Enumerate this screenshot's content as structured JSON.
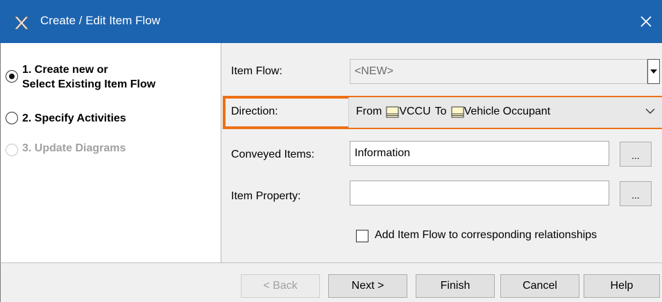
{
  "window": {
    "title": "Create / Edit Item Flow",
    "app_icon": "magicdraw-x-icon",
    "close_icon": "close-icon"
  },
  "steps": [
    {
      "line1": "1. Create new or",
      "line2": "Select Existing Item Flow",
      "selected": true,
      "enabled": true
    },
    {
      "line1": "2. Specify Activities",
      "selected": false,
      "enabled": true
    },
    {
      "line1": "3. Update Diagrams",
      "selected": false,
      "enabled": false
    }
  ],
  "form": {
    "item_flow": {
      "label": "Item Flow:",
      "value": "<NEW>"
    },
    "direction": {
      "label": "Direction:",
      "from": "From",
      "source": "VCCU",
      "to": "To",
      "target": "Vehicle Occupant",
      "highlight_color": "#ed7014"
    },
    "conveyed_items": {
      "label": "Conveyed Items:",
      "value": "Information",
      "browse": "..."
    },
    "item_property": {
      "label": "Item Property:",
      "value": "",
      "browse": "..."
    },
    "add_item_flow": {
      "label": "Add Item Flow to corresponding relationships",
      "checked": false
    }
  },
  "buttons": {
    "back": "< Back",
    "next": "Next >",
    "finish": "Finish",
    "cancel": "Cancel",
    "help": "Help"
  },
  "colors": {
    "titlebar": "#1c64b0",
    "accent_highlight": "#ed7014"
  }
}
